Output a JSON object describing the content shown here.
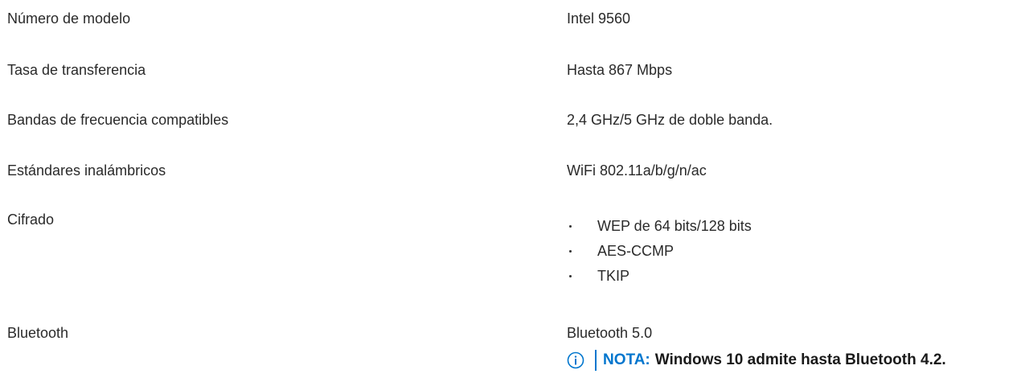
{
  "specs": {
    "model_number": {
      "label": "Número de modelo",
      "value": "Intel 9560"
    },
    "transfer_rate": {
      "label": "Tasa de transferencia",
      "value": "Hasta 867 Mbps"
    },
    "frequency_bands": {
      "label": "Bandas de frecuencia compatibles",
      "value": "2,4 GHz/5 GHz de doble banda."
    },
    "wireless_standards": {
      "label": "Estándares inalámbricos",
      "value": "WiFi 802.11a/b/g/n/ac"
    },
    "encryption": {
      "label": "Cifrado",
      "items": [
        "WEP de 64 bits/128 bits",
        "AES-CCMP",
        "TKIP"
      ]
    },
    "bluetooth": {
      "label": "Bluetooth",
      "value": "Bluetooth 5.0"
    }
  },
  "note": {
    "icon": "info-icon",
    "label": "NOTA:",
    "text": "Windows 10 admite hasta Bluetooth 4.2.",
    "accent_color": "#0076ce"
  }
}
